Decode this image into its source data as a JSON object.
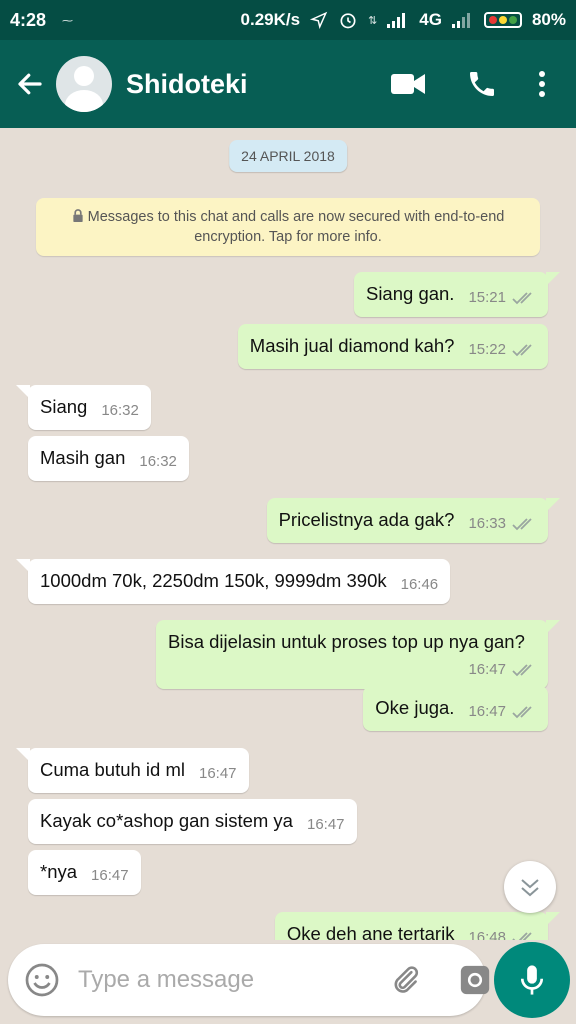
{
  "status_bar": {
    "time": "4:28",
    "speed": "0.29K/s",
    "network": "4G",
    "battery": "80%"
  },
  "header": {
    "contact_name": "Shidoteki",
    "icons": [
      "back-arrow-icon",
      "video-call-icon",
      "voice-call-icon",
      "more-options-icon"
    ]
  },
  "chat": {
    "date_chip": "24 APRIL 2018",
    "encryption_notice": "Messages to this chat and calls are now secured with end-to-end encryption. Tap for more info.",
    "messages": [
      {
        "direction": "out",
        "text": "Siang gan.",
        "time": "15:21"
      },
      {
        "direction": "out",
        "text": "Masih jual diamond kah?",
        "time": "15:22"
      },
      {
        "direction": "in",
        "text": "Siang",
        "time": "16:32"
      },
      {
        "direction": "in",
        "text": "Masih gan",
        "time": "16:32"
      },
      {
        "direction": "out",
        "text": "Pricelistnya ada gak?",
        "time": "16:33"
      },
      {
        "direction": "in",
        "text": "1000dm 70k, 2250dm 150k, 9999dm 390k",
        "time": "16:46"
      },
      {
        "direction": "out",
        "text": "Bisa dijelasin untuk proses top up nya gan?",
        "time": "16:47"
      },
      {
        "direction": "out",
        "text": "Oke juga.",
        "time": "16:47"
      },
      {
        "direction": "in",
        "text": "Cuma butuh id ml",
        "time": "16:47"
      },
      {
        "direction": "in",
        "text": "Kayak co*ashop gan sistem ya",
        "time": "16:47"
      },
      {
        "direction": "in",
        "text": "*nya",
        "time": "16:47"
      },
      {
        "direction": "out",
        "text": "Oke deh ane tertarik",
        "time": "16:48"
      }
    ]
  },
  "composer": {
    "placeholder": "Type a message"
  },
  "colors": {
    "status_bar": "#054d44",
    "app_bar": "#075e54",
    "chat_bg": "#e5ddd5",
    "outgoing_bubble": "#dcf8c6",
    "incoming_bubble": "#ffffff",
    "mic_button": "#00897b",
    "read_ticks": "#9aa6a0"
  }
}
